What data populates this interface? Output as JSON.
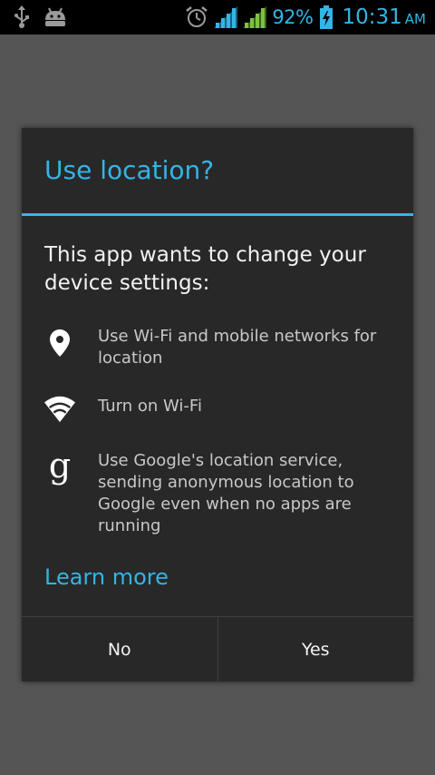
{
  "status_bar": {
    "left_icons": [
      "usb-icon",
      "android-debug-icon"
    ],
    "right_icons": [
      "alarm-icon",
      "signal-icon-sim1",
      "signal-icon-sim2",
      "battery-charging-icon"
    ],
    "battery_percent": "92%",
    "time": "10:31",
    "ampm": "AM"
  },
  "dialog": {
    "title": "Use location?",
    "message": "This app wants to change your device settings:",
    "permissions": [
      {
        "icon": "location-pin-icon",
        "text": "Use Wi-Fi and mobile networks for location"
      },
      {
        "icon": "wifi-icon",
        "text": "Turn on Wi-Fi"
      },
      {
        "icon": "google-g-icon",
        "text": "Use Google's location service, sending anonymous location to Google even when no apps are running"
      }
    ],
    "learn_more": "Learn more",
    "buttons": {
      "negative": "No",
      "positive": "Yes"
    }
  },
  "colors": {
    "accent": "#33b5e5",
    "dialog_bg": "#282828",
    "backdrop": "#555555",
    "status_bar_bg": "#000000"
  }
}
